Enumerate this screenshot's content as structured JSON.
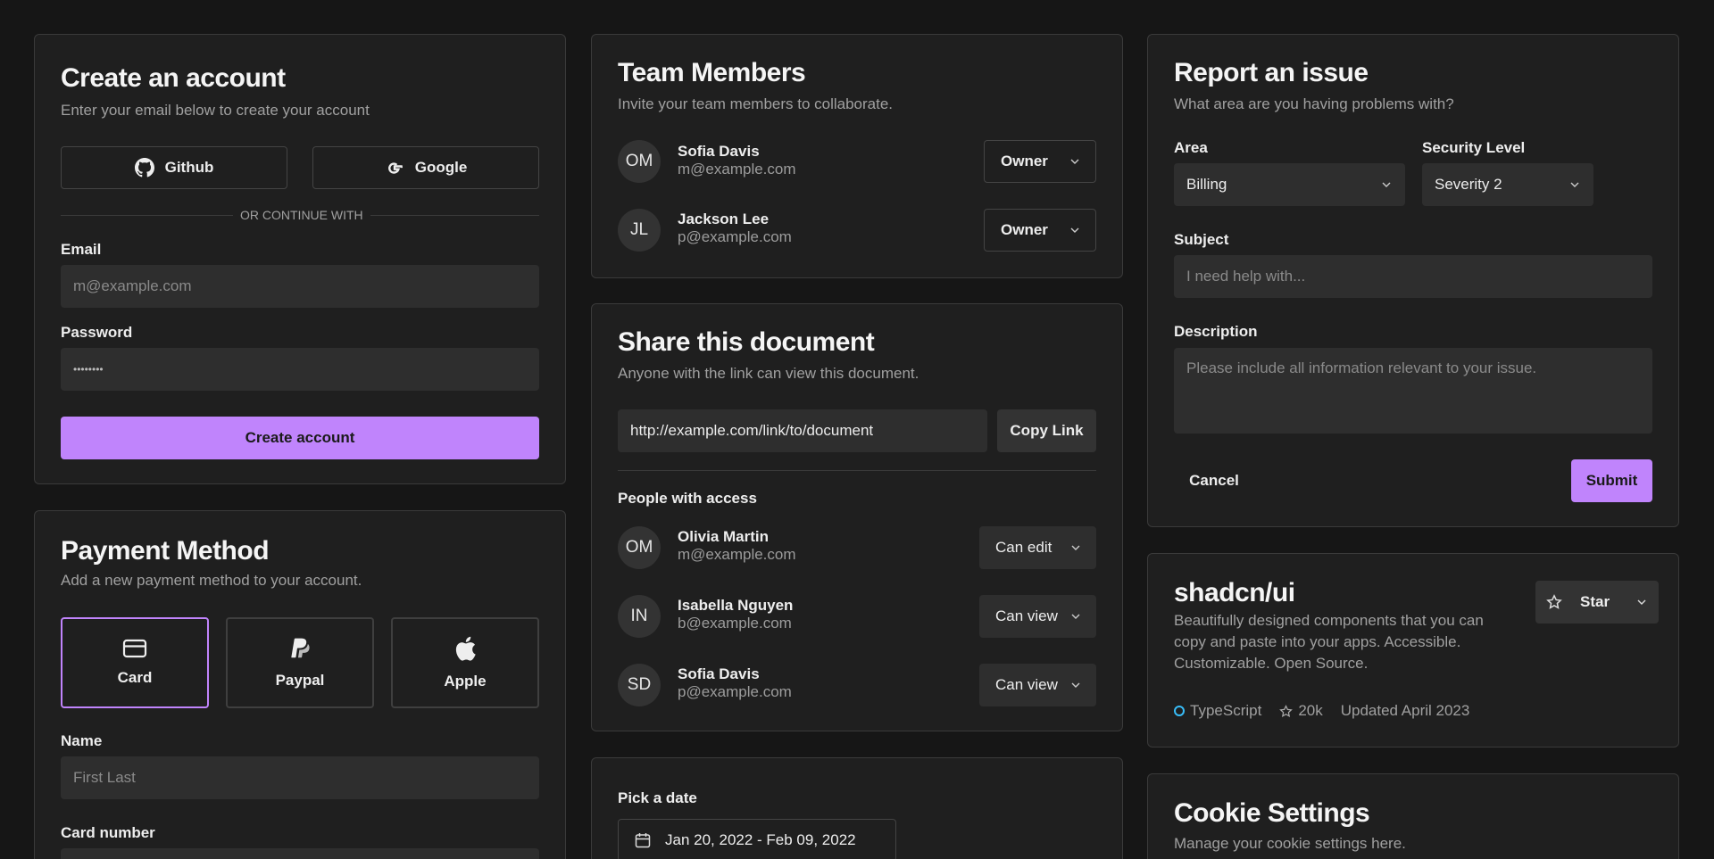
{
  "create_account": {
    "title": "Create an account",
    "subtitle": "Enter your email below to create your account",
    "github_label": "Github",
    "google_label": "Google",
    "divider_text": "OR CONTINUE WITH",
    "email_label": "Email",
    "email_placeholder": "m@example.com",
    "password_label": "Password",
    "password_value": "••••••••",
    "submit_label": "Create account"
  },
  "payment": {
    "title": "Payment Method",
    "subtitle": "Add a new payment method to your account.",
    "options": [
      {
        "label": "Card",
        "icon": "credit-card-icon",
        "selected": true
      },
      {
        "label": "Paypal",
        "icon": "paypal-icon",
        "selected": false
      },
      {
        "label": "Apple",
        "icon": "apple-icon",
        "selected": false
      }
    ],
    "name_label": "Name",
    "name_placeholder": "First Last",
    "card_number_label": "Card number"
  },
  "team": {
    "title": "Team Members",
    "subtitle": "Invite your team members to collaborate.",
    "members": [
      {
        "initials": "OM",
        "name": "Sofia Davis",
        "email": "m@example.com",
        "role": "Owner"
      },
      {
        "initials": "JL",
        "name": "Jackson Lee",
        "email": "p@example.com",
        "role": "Owner"
      }
    ]
  },
  "share": {
    "title": "Share this document",
    "subtitle": "Anyone with the link can view this document.",
    "link": "http://example.com/link/to/document",
    "copy_label": "Copy Link",
    "people_label": "People with access",
    "people": [
      {
        "initials": "OM",
        "name": "Olivia Martin",
        "email": "m@example.com",
        "permission": "Can edit"
      },
      {
        "initials": "IN",
        "name": "Isabella Nguyen",
        "email": "b@example.com",
        "permission": "Can view"
      },
      {
        "initials": "SD",
        "name": "Sofia Davis",
        "email": "p@example.com",
        "permission": "Can view"
      }
    ]
  },
  "date": {
    "label": "Pick a date",
    "range": "Jan 20, 2022 - Feb 09, 2022"
  },
  "report": {
    "title": "Report an issue",
    "subtitle": "What area are you having problems with?",
    "area_label": "Area",
    "area_value": "Billing",
    "security_label": "Security Level",
    "security_value": "Severity 2",
    "subject_label": "Subject",
    "subject_placeholder": "I need help with...",
    "description_label": "Description",
    "description_placeholder": "Please include all information relevant to your issue.",
    "cancel_label": "Cancel",
    "submit_label": "Submit"
  },
  "repo": {
    "title": "shadcn/ui",
    "description": "Beautifully designed components that you can copy and paste into your apps. Accessible. Customizable. Open Source.",
    "star_label": "Star",
    "language": "TypeScript",
    "stars": "20k",
    "updated": "Updated April 2023",
    "language_color": "#38bdf8"
  },
  "cookies": {
    "title": "Cookie Settings",
    "subtitle": "Manage your cookie settings here."
  },
  "colors": {
    "accent": "#c084fc",
    "background": "#161616",
    "card": "#1f1f1f"
  }
}
